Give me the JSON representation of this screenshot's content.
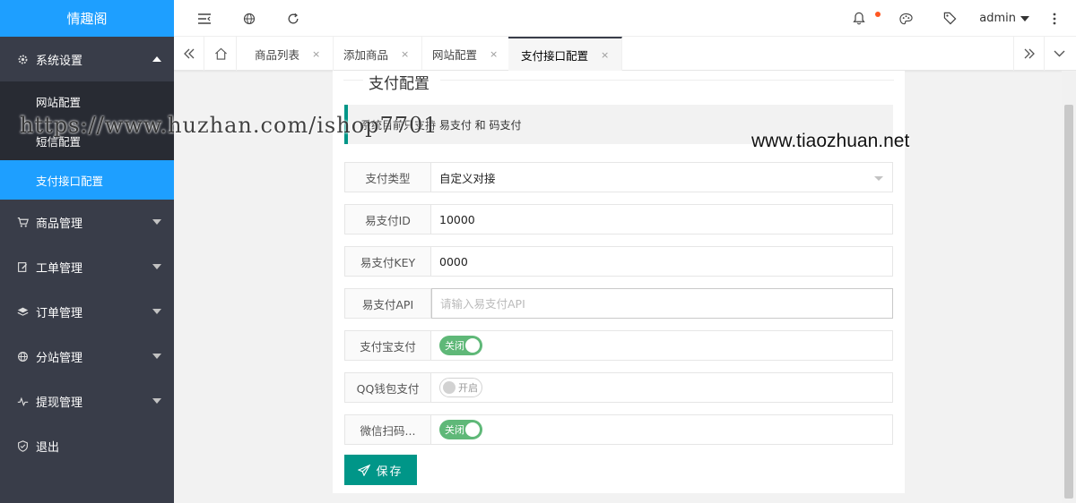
{
  "app": {
    "logo_text": "情趣阁"
  },
  "header": {
    "user_name": "admin"
  },
  "sidebar": {
    "system_settings": {
      "label": "系统设置",
      "icon": "gear-icon"
    },
    "submenu": [
      {
        "label": "网站配置"
      },
      {
        "label": "短信配置"
      },
      {
        "label": "支付接口配置",
        "active": true
      }
    ],
    "items": [
      {
        "label": "商品管理",
        "icon": "cart-icon"
      },
      {
        "label": "工单管理",
        "icon": "edit-icon"
      },
      {
        "label": "订单管理",
        "icon": "layers-icon"
      },
      {
        "label": "分站管理",
        "icon": "globe-icon"
      },
      {
        "label": "提现管理",
        "icon": "pulse-icon"
      },
      {
        "label": "退出",
        "icon": "shield-icon"
      }
    ]
  },
  "tabs": [
    {
      "label": "商品列表",
      "close": "×"
    },
    {
      "label": "添加商品",
      "close": "×"
    },
    {
      "label": "网站配置",
      "close": "×"
    },
    {
      "label": "支付接口配置",
      "close": "×",
      "active": true
    }
  ],
  "form": {
    "section_title": "支付配置",
    "notice": "系统目前只支持 易支付 和 码支付",
    "pay_type": {
      "label": "支付类型",
      "value": "自定义对接"
    },
    "epay_id": {
      "label": "易支付ID",
      "value": "10000"
    },
    "epay_key": {
      "label": "易支付KEY",
      "value": "0000"
    },
    "epay_api": {
      "label": "易支付API",
      "value": "",
      "placeholder": "请输入易支付API"
    },
    "alipay": {
      "label": "支付宝支付",
      "switch_text": "关闭",
      "on": true
    },
    "qq_wallet": {
      "label": "QQ钱包支付",
      "switch_text": "开启",
      "on": false
    },
    "wechat": {
      "label": "微信扫码...",
      "switch_text": "关闭",
      "on": true
    },
    "save_label": "保存"
  },
  "watermarks": {
    "left": "https://www.huzhan.com/ishop7701",
    "right": "www.tiaozhuan.net"
  },
  "colors": {
    "sidebar_bg": "#393d49",
    "accent_blue": "#1e9fff",
    "primary_green": "#009688",
    "switch_on": "#5fb878",
    "badge_dot": "#ff5722"
  }
}
